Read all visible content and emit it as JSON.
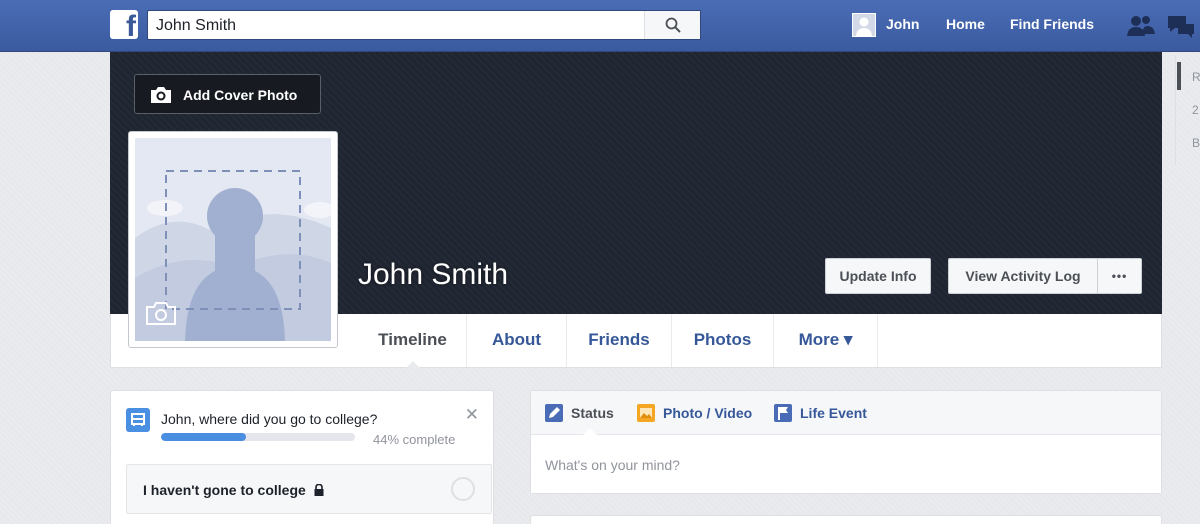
{
  "topbar": {
    "logo": "f",
    "search_value": "John Smith",
    "user_name": "John",
    "home": "Home",
    "find_friends": "Find Friends"
  },
  "cover": {
    "add_cover_label": "Add Cover Photo",
    "profile_name": "John Smith",
    "update_info": "Update Info",
    "view_activity_log": "View Activity Log",
    "more_dots": "•••"
  },
  "tabs": [
    {
      "label": "Timeline",
      "active": true
    },
    {
      "label": "About"
    },
    {
      "label": "Friends"
    },
    {
      "label": "Photos"
    },
    {
      "label": "More ▾"
    }
  ],
  "college_prompt": {
    "question": "John, where did you go to college?",
    "progress": 0.44,
    "progress_text": "44% complete",
    "answer_option": "I haven't gone to college",
    "close": "✕"
  },
  "composer": {
    "tabs": [
      {
        "label": "Status",
        "icon": "pencil-icon",
        "color": "#4a6bb5"
      },
      {
        "label": "Photo / Video",
        "icon": "photo-icon",
        "color": "#f5a623"
      },
      {
        "label": "Life Event",
        "icon": "flag-icon",
        "color": "#4a6bb5"
      }
    ],
    "placeholder": "What's on your mind?"
  },
  "right_sidebar": [
    "R",
    "2",
    "B"
  ],
  "colors": {
    "brand": "#3b5998",
    "cover": "#1f2531",
    "link": "#365899"
  }
}
